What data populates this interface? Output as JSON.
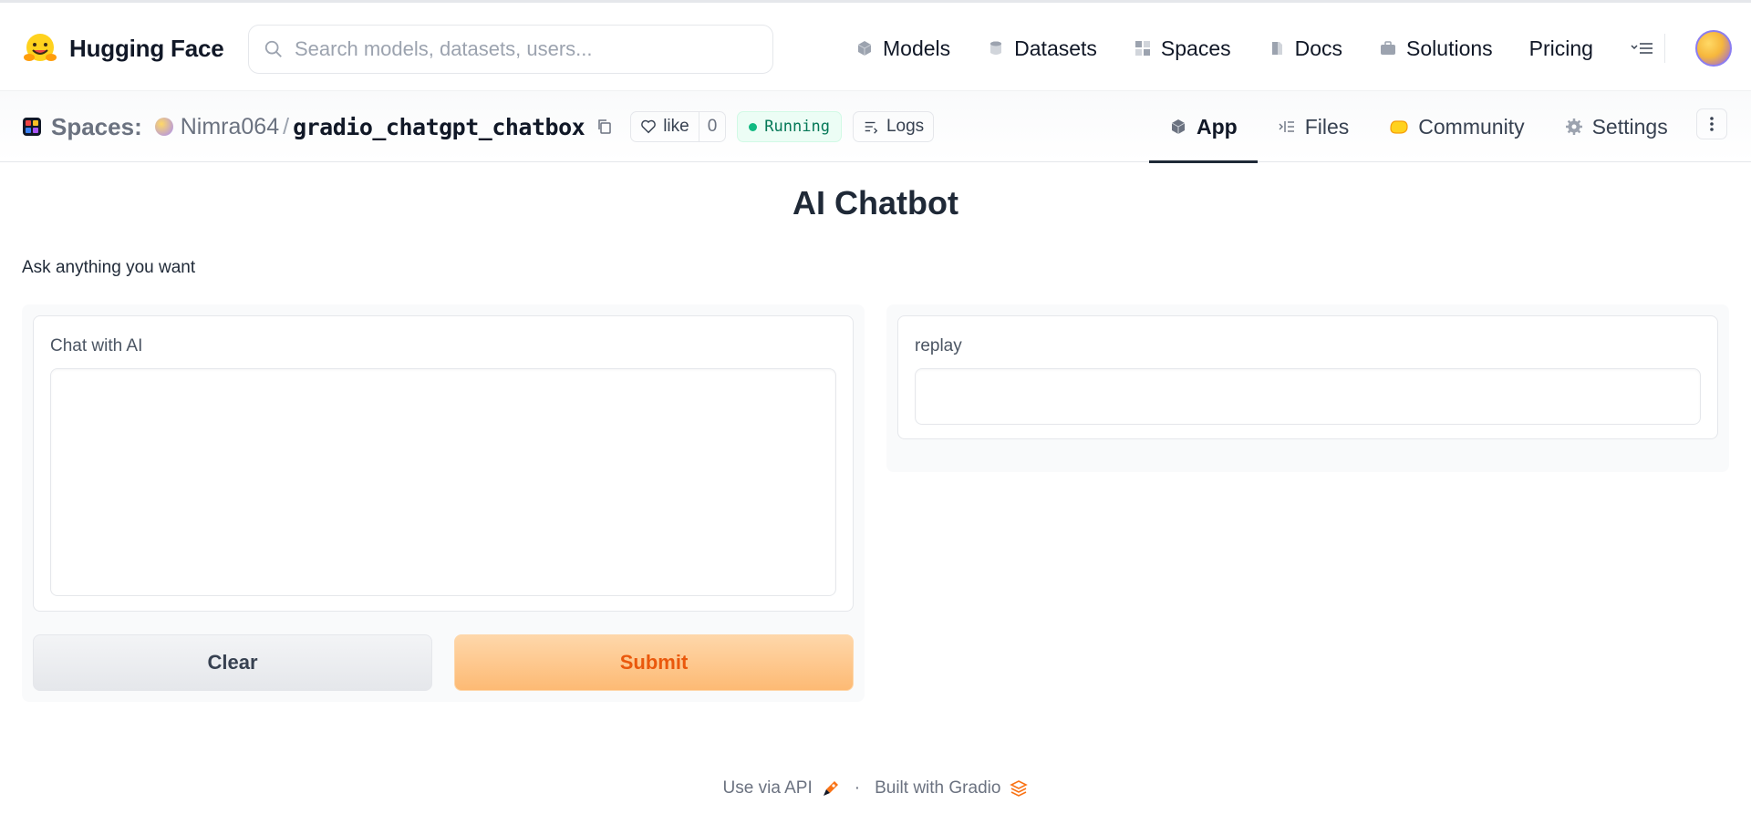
{
  "topnav": {
    "brand": "Hugging Face",
    "search_placeholder": "Search models, datasets, users...",
    "links": [
      {
        "label": "Models",
        "icon": "cube-icon"
      },
      {
        "label": "Datasets",
        "icon": "database-icon"
      },
      {
        "label": "Spaces",
        "icon": "spaces-grid-icon"
      },
      {
        "label": "Docs",
        "icon": "docs-icon"
      },
      {
        "label": "Solutions",
        "icon": "briefcase-icon"
      },
      {
        "label": "Pricing",
        "icon": ""
      }
    ]
  },
  "space": {
    "section": "Spaces:",
    "owner": "Nimra064",
    "separator": "/",
    "repo": "gradio_chatgpt_chatbox",
    "like_label": "like",
    "like_count": "0",
    "status": "Running",
    "logs_label": "Logs",
    "tabs": [
      {
        "label": "App",
        "active": true
      },
      {
        "label": "Files",
        "active": false
      },
      {
        "label": "Community",
        "active": false
      },
      {
        "label": "Settings",
        "active": false
      }
    ]
  },
  "app": {
    "title": "AI Chatbot",
    "description": "Ask anything you want",
    "input_label": "Chat with AI",
    "input_value": "",
    "output_label": "replay",
    "output_value": "",
    "clear_label": "Clear",
    "submit_label": "Submit"
  },
  "footer": {
    "api_label": "Use via API",
    "dot": "·",
    "built_label": "Built with Gradio"
  },
  "colors": {
    "accent_orange": "#ea580c",
    "running_green": "#10b981"
  }
}
